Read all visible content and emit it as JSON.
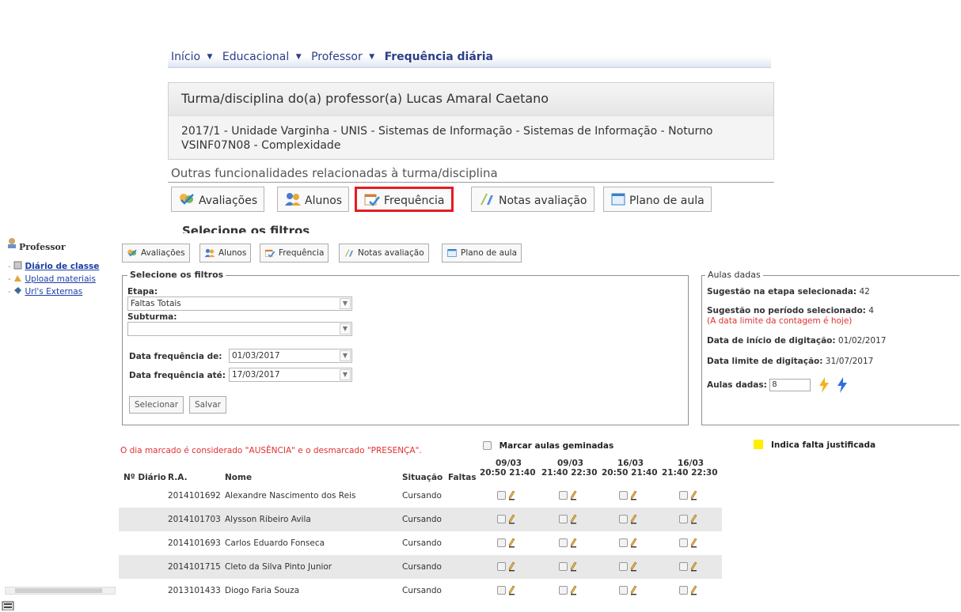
{
  "breadcrumb": {
    "inicio": "Início",
    "educacional": "Educacional",
    "professor": "Professor",
    "current": "Frequência diária"
  },
  "panel": {
    "title": "Turma/disciplina do(a) professor(a) Lucas Amaral Caetano",
    "line1": "2017/1 - Unidade Varginha - UNIS - Sistemas de Informação - Sistemas de Informação - Noturno",
    "line2": "VSINF07N08 - Complexidade"
  },
  "other_title": "Outras funcionalidades relacionadas à turma/disciplina",
  "tabs": {
    "avaliacoes": "Avaliações",
    "alunos": "Alunos",
    "frequencia": "Frequência",
    "notas": "Notas avaliação",
    "plano": "Plano de aula"
  },
  "cut_text": "Selecione os filtros",
  "sidebar": {
    "title": "Professor",
    "items": [
      "Diário de classe",
      "Upload materiais",
      "Url's Externas"
    ]
  },
  "filters": {
    "legend": "Selecione os filtros",
    "etapa_label": "Etapa:",
    "etapa_value": "Faltas Totais",
    "subturma_label": "Subturma:",
    "subturma_value": "",
    "de_label": "Data frequência de:",
    "de_value": "01/03/2017",
    "ate_label": "Data frequência até:",
    "ate_value": "17/03/2017",
    "selecionar": "Selecionar",
    "salvar": "Salvar"
  },
  "aulas": {
    "legend": "Aulas dadas",
    "sug_etapa_label": "Sugestão na etapa selecionada:",
    "sug_etapa_value": "42",
    "sug_periodo_label": "Sugestão no período selecionado:",
    "sug_periodo_value": "4",
    "sug_note": "(A data limite da contagem é hoje)",
    "inicio_label": "Data de início de digitação:",
    "inicio_value": "01/02/2017",
    "limite_label": "Data limite de digitação:",
    "limite_value": "31/07/2017",
    "dadas_label": "Aulas dadas:",
    "dadas_value": "8"
  },
  "notice": "O dia marcado é considerado \"AUSÊNCIA\" e o desmarcado \"PRESENÇA\".",
  "geminadas": "Marcar aulas geminadas",
  "justificada": "Indica falta justificada",
  "table": {
    "headers": {
      "num": "Nº Diário",
      "ra": "R.A.",
      "nome": "Nome",
      "situacao": "Situação",
      "faltas": "Faltas"
    },
    "sessions": [
      {
        "date": "09/03",
        "time": "20:50 21:40"
      },
      {
        "date": "09/03",
        "time": "21:40 22:30"
      },
      {
        "date": "16/03",
        "time": "20:50 21:40"
      },
      {
        "date": "16/03",
        "time": "21:40 22:30"
      }
    ],
    "rows": [
      {
        "ra": "2014101692",
        "nome": "Alexandre Nascimento dos Reis",
        "situacao": "Cursando"
      },
      {
        "ra": "2014101703",
        "nome": "Alysson Ribeiro Avila",
        "situacao": "Cursando"
      },
      {
        "ra": "2014101693",
        "nome": "Carlos Eduardo Fonseca",
        "situacao": "Cursando"
      },
      {
        "ra": "2014101715",
        "nome": "Cleto da Silva Pinto Junior",
        "situacao": "Cursando"
      },
      {
        "ra": "2013101433",
        "nome": "Diogo Faria Souza",
        "situacao": "Cursando"
      }
    ]
  },
  "icons": {
    "avaliacoes": "check-group-icon",
    "alunos": "users-icon",
    "frequencia": "calendar-check-icon",
    "notas": "grades-icon",
    "plano": "window-icon",
    "lightning_yellow": "lightning-yellow-icon",
    "lightning_blue": "lightning-blue-icon"
  },
  "colors": {
    "highlight": "#e51b23",
    "link": "#1b3ea6",
    "notice": "#e23030",
    "justified": "#ffee00",
    "row_alt": "#e8e8e8"
  }
}
